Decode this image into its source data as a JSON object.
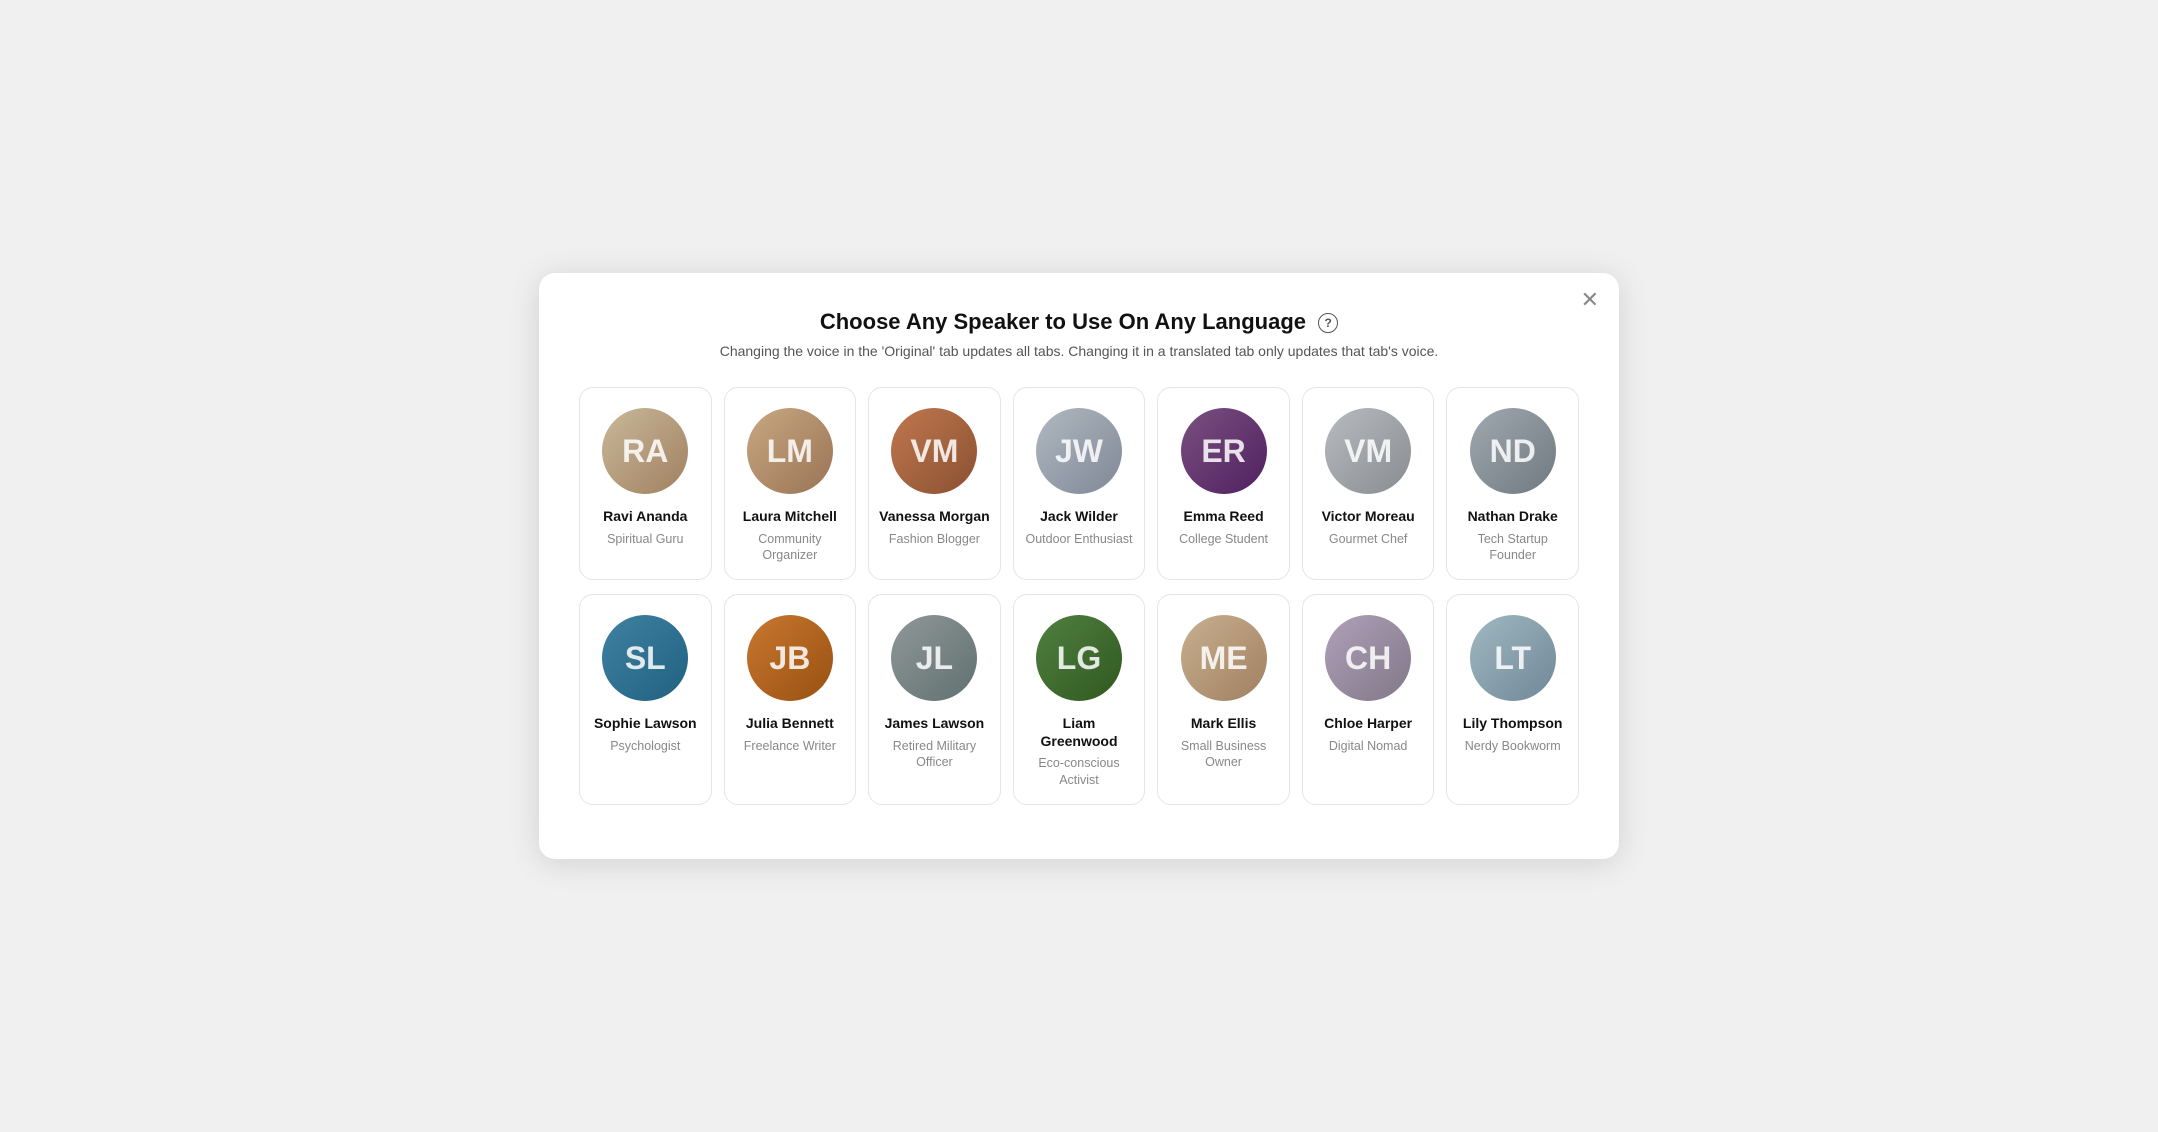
{
  "modal": {
    "title": "Choose Any Speaker to Use On Any Language",
    "subtitle": "Changing the voice in the 'Original' tab updates all tabs. Changing it in a translated tab only updates that tab's voice.",
    "help_label": "?",
    "close_label": "✕"
  },
  "row1": [
    {
      "id": "ravi",
      "name": "Ravi Ananda",
      "role": "Spiritual Guru",
      "initials": "RA",
      "color_class": "av-ravi"
    },
    {
      "id": "laura",
      "name": "Laura Mitchell",
      "role": "Community Organizer",
      "initials": "LM",
      "color_class": "av-laura"
    },
    {
      "id": "vanessa",
      "name": "Vanessa Morgan",
      "role": "Fashion Blogger",
      "initials": "VM",
      "color_class": "av-vanessa"
    },
    {
      "id": "jack",
      "name": "Jack Wilder",
      "role": "Outdoor Enthusiast",
      "initials": "JW",
      "color_class": "av-jack"
    },
    {
      "id": "emma",
      "name": "Emma Reed",
      "role": "College Student",
      "initials": "ER",
      "color_class": "av-emma"
    },
    {
      "id": "victor",
      "name": "Victor Moreau",
      "role": "Gourmet Chef",
      "initials": "VM",
      "color_class": "av-victor"
    },
    {
      "id": "nathan",
      "name": "Nathan Drake",
      "role": "Tech Startup Founder",
      "initials": "ND",
      "color_class": "av-nathan"
    }
  ],
  "row2": [
    {
      "id": "sophie",
      "name": "Sophie Lawson",
      "role": "Psychologist",
      "initials": "SL",
      "color_class": "av-sophie"
    },
    {
      "id": "julia",
      "name": "Julia Bennett",
      "role": "Freelance Writer",
      "initials": "JB",
      "color_class": "av-julia"
    },
    {
      "id": "james",
      "name": "James Lawson",
      "role": "Retired Military Officer",
      "initials": "JL",
      "color_class": "av-james"
    },
    {
      "id": "liam",
      "name": "Liam Greenwood",
      "role": "Eco-conscious Activist",
      "initials": "LG",
      "color_class": "av-liam"
    },
    {
      "id": "mark",
      "name": "Mark Ellis",
      "role": "Small Business Owner",
      "initials": "ME",
      "color_class": "av-mark"
    },
    {
      "id": "chloe",
      "name": "Chloe Harper",
      "role": "Digital Nomad",
      "initials": "CH",
      "color_class": "av-chloe"
    },
    {
      "id": "lily",
      "name": "Lily Thompson",
      "role": "Nerdy Bookworm",
      "initials": "LT",
      "color_class": "av-lily"
    }
  ]
}
